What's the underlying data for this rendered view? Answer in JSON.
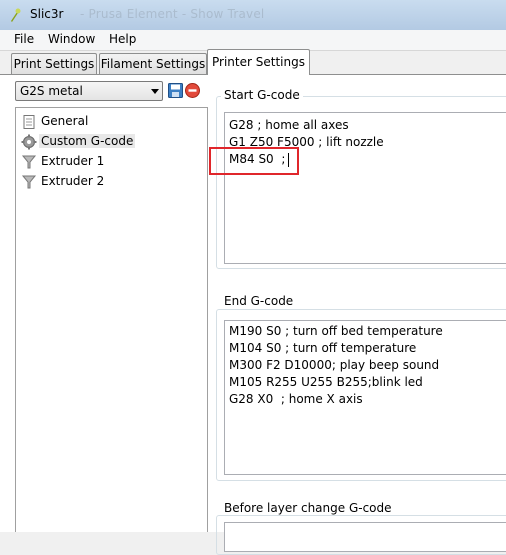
{
  "window": {
    "title": "Slic3r",
    "title_ghost": "- Prusa Element - Show Travel"
  },
  "menu": [
    "File",
    "Window",
    "Help"
  ],
  "tabs": [
    "Print Settings",
    "Filament Settings",
    "Printer Settings"
  ],
  "active_tab": "Printer Settings",
  "preset": {
    "selected": "G2S metal"
  },
  "tree": [
    {
      "label": "General",
      "icon": "page-icon"
    },
    {
      "label": "Custom G-code",
      "icon": "gear-icon",
      "selected": true
    },
    {
      "label": "Extruder 1",
      "icon": "funnel-icon"
    },
    {
      "label": "Extruder 2",
      "icon": "funnel-icon"
    }
  ],
  "start_gcode": {
    "title": "Start G-code",
    "lines": [
      "G28 ; home all axes",
      "G1 Z50 F5000 ; lift nozzle",
      "M84 S0  ;"
    ]
  },
  "end_gcode": {
    "title": "End G-code",
    "lines": [
      "M190 S0 ; turn off bed temperature",
      "M104 S0 ; turn off temperature",
      "M300 F2 D10000; play beep sound",
      "M105 R255 U255 B255;blink led",
      "G28 X0  ; home X axis"
    ]
  },
  "before_layer_gcode": {
    "title": "Before layer change G-code"
  },
  "colors": {
    "highlight": "#e0262b",
    "accent": "#3c7fc4"
  }
}
